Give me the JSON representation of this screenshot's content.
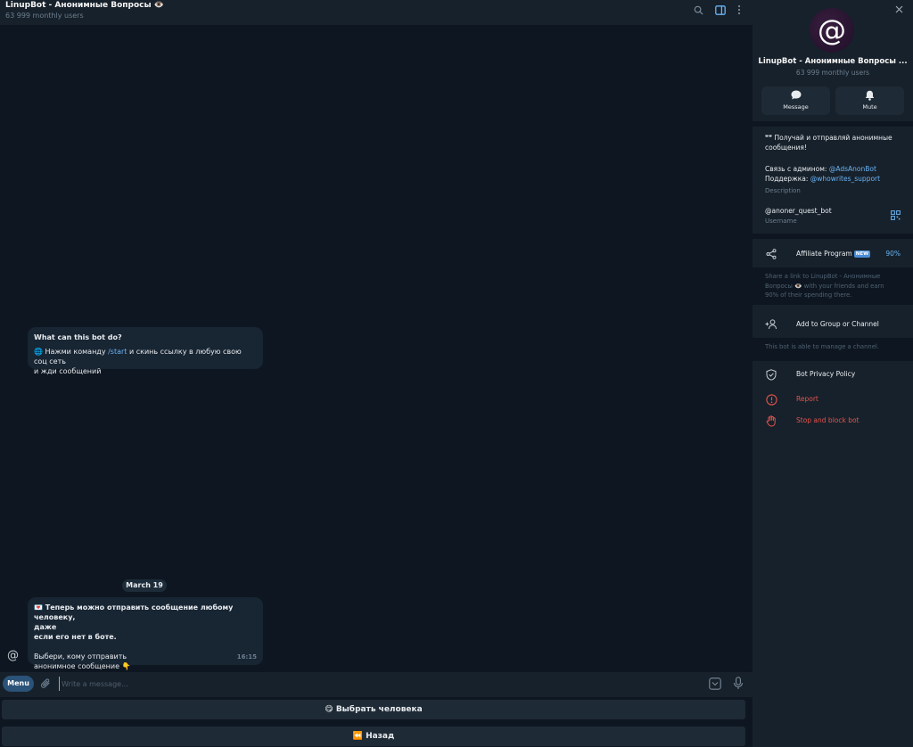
{
  "chat": {
    "title": "LinupBot - Анонимные Вопросы 👁️",
    "subtitle": "63 999 monthly users",
    "intro": {
      "heading": "What can this bot do?",
      "line1_pre": "🌐 Нажми команду ",
      "line1_link": "/start",
      "line1_post": " и скинь ссылку в любую свою соц сеть",
      "line2": "и жди сообщений"
    },
    "date": "March 19",
    "message": {
      "line1": "💌 Теперь можно отправить сообщение любому человеку,",
      "line2": "даже",
      "line3": "если его нет в боте.",
      "line4": "Выбери, кому отправить",
      "line5": "анонимное сообщение 👇",
      "time": "16:15"
    },
    "avatar_glyph": "@",
    "menu_label": "Menu",
    "input_placeholder": "Write a message...",
    "keyboard": {
      "btn1": "😋 Выбрать человека",
      "btn2": "⏪ Назад"
    }
  },
  "panel": {
    "avatar_glyph": "@",
    "title": "LinupBot - Анонимные Вопросы ...",
    "subtitle": "63 999 monthly users",
    "message_label": "Message",
    "mute_label": "Mute",
    "desc_line1": "❞❞ Получай и отправляй анонимные",
    "desc_line2": "сообщения!",
    "admin_pre": "Связь с админом: ",
    "admin_link": "@AdsAnonBot",
    "support_pre": "Поддержка: ",
    "support_link": "@whowrites_support",
    "description_label": "Description",
    "username": "@anoner_quest_bot",
    "username_label": "Username",
    "affiliate_label": "Affiliate Program",
    "new_badge": "NEW",
    "affiliate_pct": "90%",
    "affiliate_note1": "Share a link to LinupBot - Анонимные",
    "affiliate_note2": "Вопросы 👁️ with your friends and earn",
    "affiliate_note3": "90% of their spending there.",
    "add_group_label": "Add to Group or Channel",
    "add_group_note": "This bot is able to manage a channel.",
    "privacy_label": "Bot Privacy Policy",
    "report_label": "Report",
    "stop_label": "Stop and block bot"
  },
  "colors": {
    "bg": "#0e1621",
    "surface": "#17212b",
    "bubble": "#182533",
    "link": "#6ab3f3",
    "danger": "#e5534b"
  }
}
